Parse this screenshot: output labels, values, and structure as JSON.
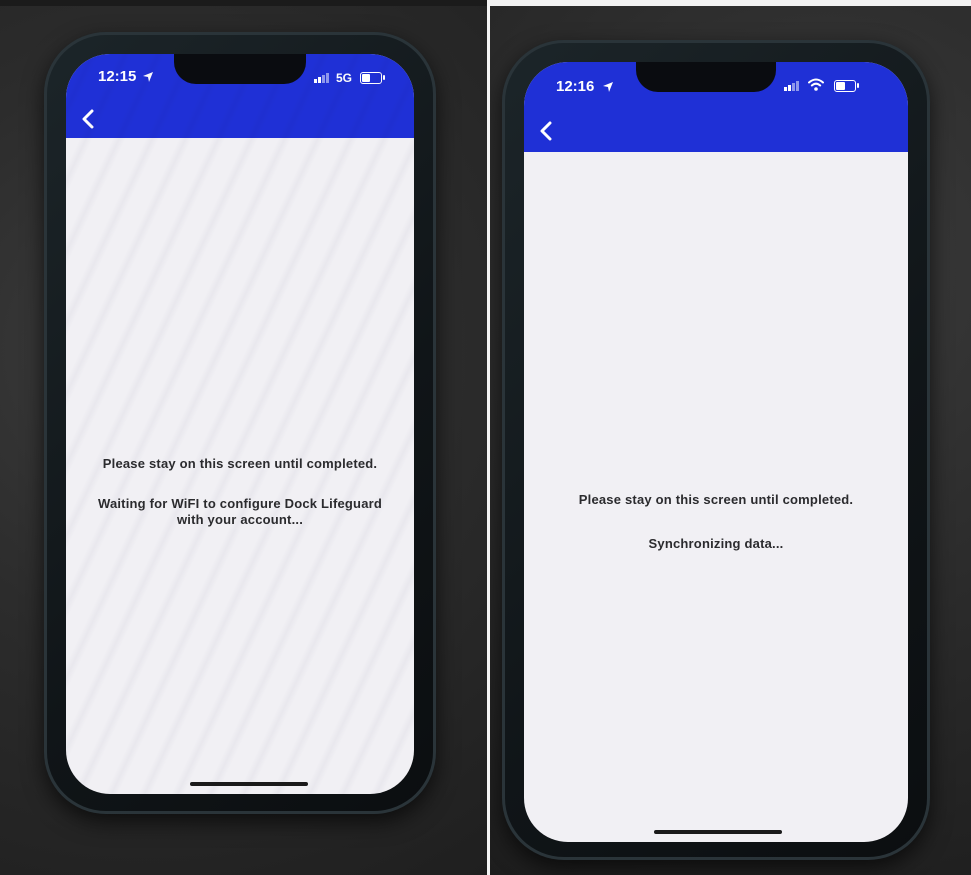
{
  "screenshots": [
    {
      "status_time": "12:15",
      "network": "5G",
      "back_icon": "chevron-left-icon",
      "header_color": "#1f30d6",
      "message_primary": "Please stay on this screen until completed.",
      "message_secondary": "Waiting for WiFI to configure Dock Lifeguard with your account..."
    },
    {
      "status_time": "12:16",
      "network": "wifi",
      "back_icon": "chevron-left-icon",
      "header_color": "#1f30d6",
      "message_primary": "Please stay on this screen until completed.",
      "message_secondary": "Synchronizing data..."
    }
  ]
}
